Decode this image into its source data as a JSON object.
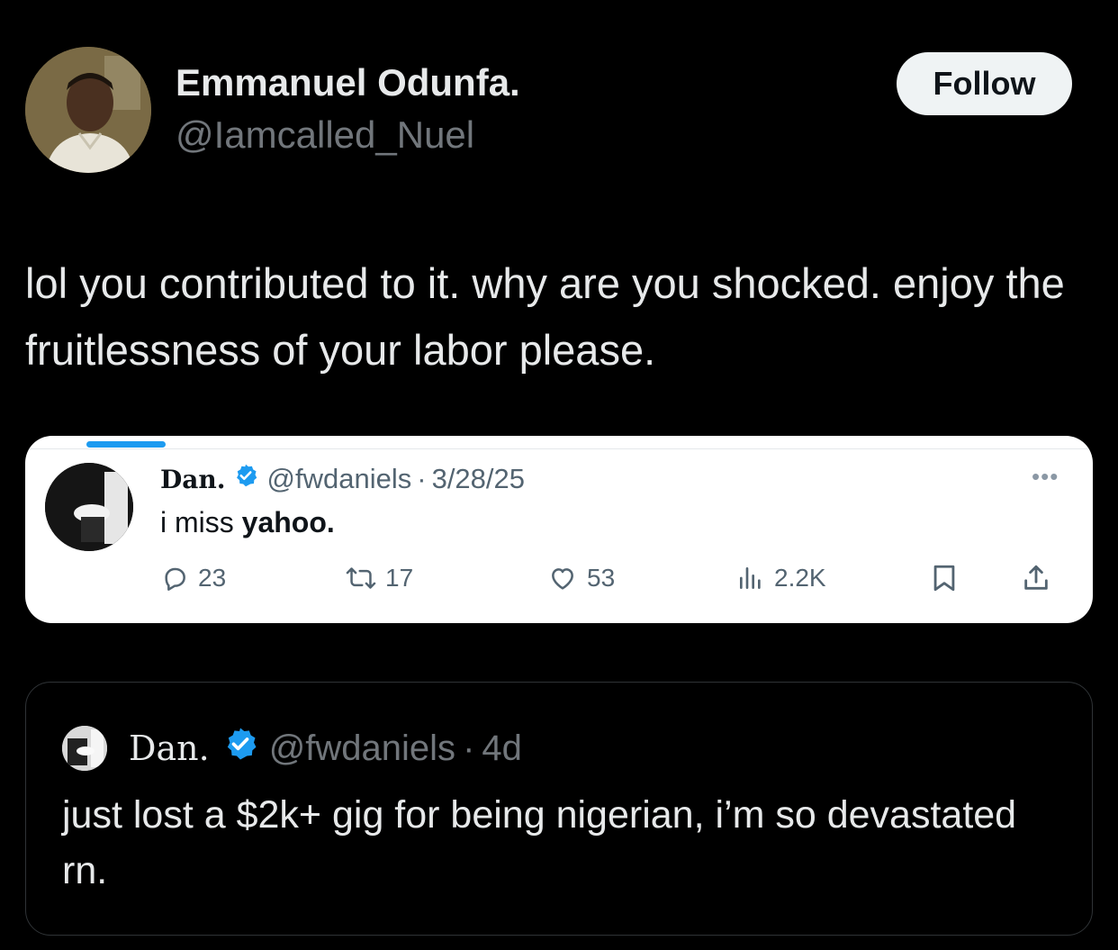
{
  "post": {
    "author": {
      "name": "Emmanuel Odunfa.",
      "handle": "@Iamcalled_Nuel"
    },
    "follow_label": "Follow",
    "text": "lol you contributed to it. why are you shocked. enjoy the fruitlessness of your labor please."
  },
  "embedded_screenshot": {
    "author": {
      "name": "Dan.",
      "handle": "@fwdaniels",
      "separator": "·",
      "date": "3/28/25"
    },
    "text_prefix": "i miss ",
    "text_bold": "yahoo.",
    "more_label": "•••",
    "actions": {
      "replies": "23",
      "reposts": "17",
      "likes": "53",
      "views": "2.2K"
    }
  },
  "quoted_post": {
    "author": {
      "name": "Dan.",
      "handle": "@fwdaniels",
      "separator": "·",
      "time": "4d"
    },
    "text": "just lost a $2k+ gig for being nigerian, i’m so devastated rn."
  },
  "colors": {
    "background": "#000000",
    "verified": "#1d9bf0",
    "follow_bg": "#eff3f4",
    "secondary_text": "#71767b"
  }
}
